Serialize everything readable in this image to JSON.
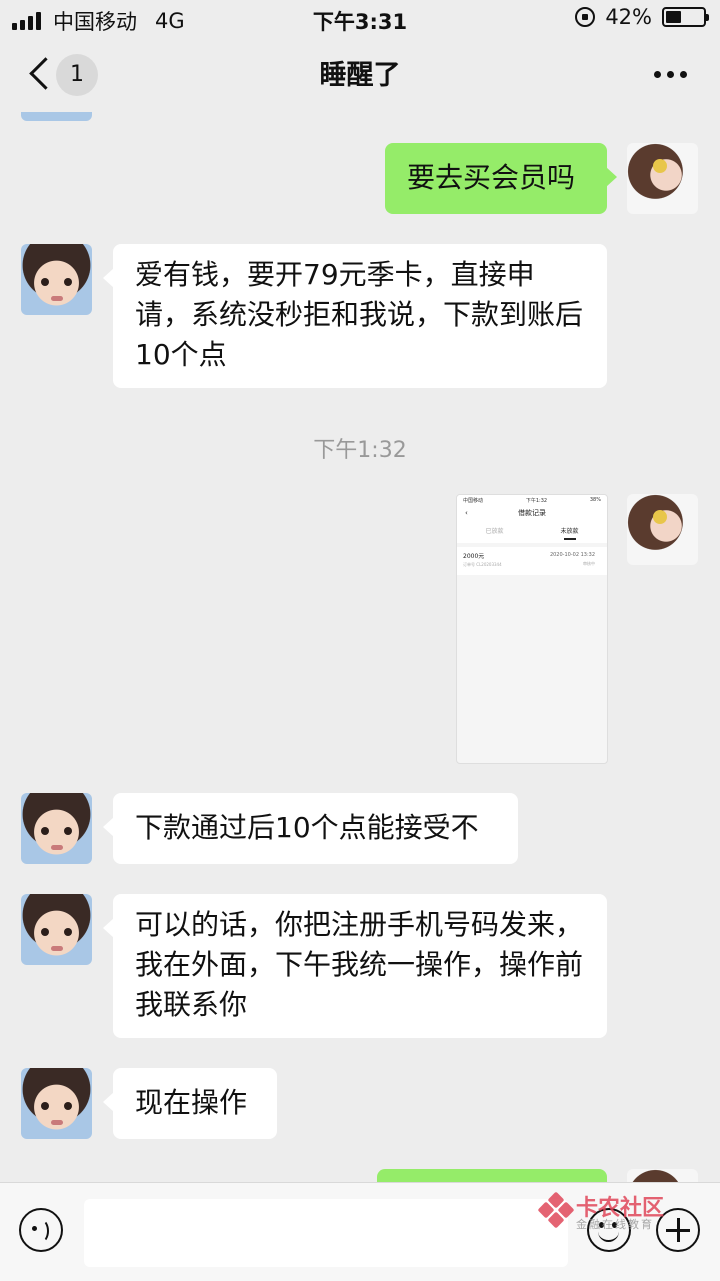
{
  "status_bar": {
    "carrier": "中国移动",
    "network": "4G",
    "time": "下午3:31",
    "battery_text": "42%",
    "battery_level": 0.42
  },
  "nav": {
    "unread_badge": "1",
    "title": "睡醒了"
  },
  "messages": [
    {
      "side": "right",
      "text": "要去买会员吗"
    },
    {
      "side": "left",
      "text": "爱有钱，要开79元季卡，直接申请，系统没秒拒和我说，下款到账后10个点"
    },
    {
      "type": "timestamp",
      "text": "下午1:32"
    },
    {
      "side": "right",
      "type": "image",
      "screenshot": {
        "carrier": "中国移动",
        "time": "下午1:32",
        "battery": "38%",
        "title": "借款记录",
        "tabs": [
          "已放款",
          "未放款"
        ],
        "amount": "2000元",
        "order": "订单号 CL20203344",
        "date": "2020-10-02 13:32",
        "status": "审核中"
      }
    },
    {
      "side": "left",
      "text": "下款通过后10个点能接受不"
    },
    {
      "side": "left",
      "text": "可以的话，你把注册手机号码发来，我在外面，下午我统一操作，操作前我联系你"
    },
    {
      "side": "left",
      "text": "现在操作"
    }
  ],
  "watermark": {
    "text": "卡农社区",
    "sub": "金融在线教育"
  }
}
